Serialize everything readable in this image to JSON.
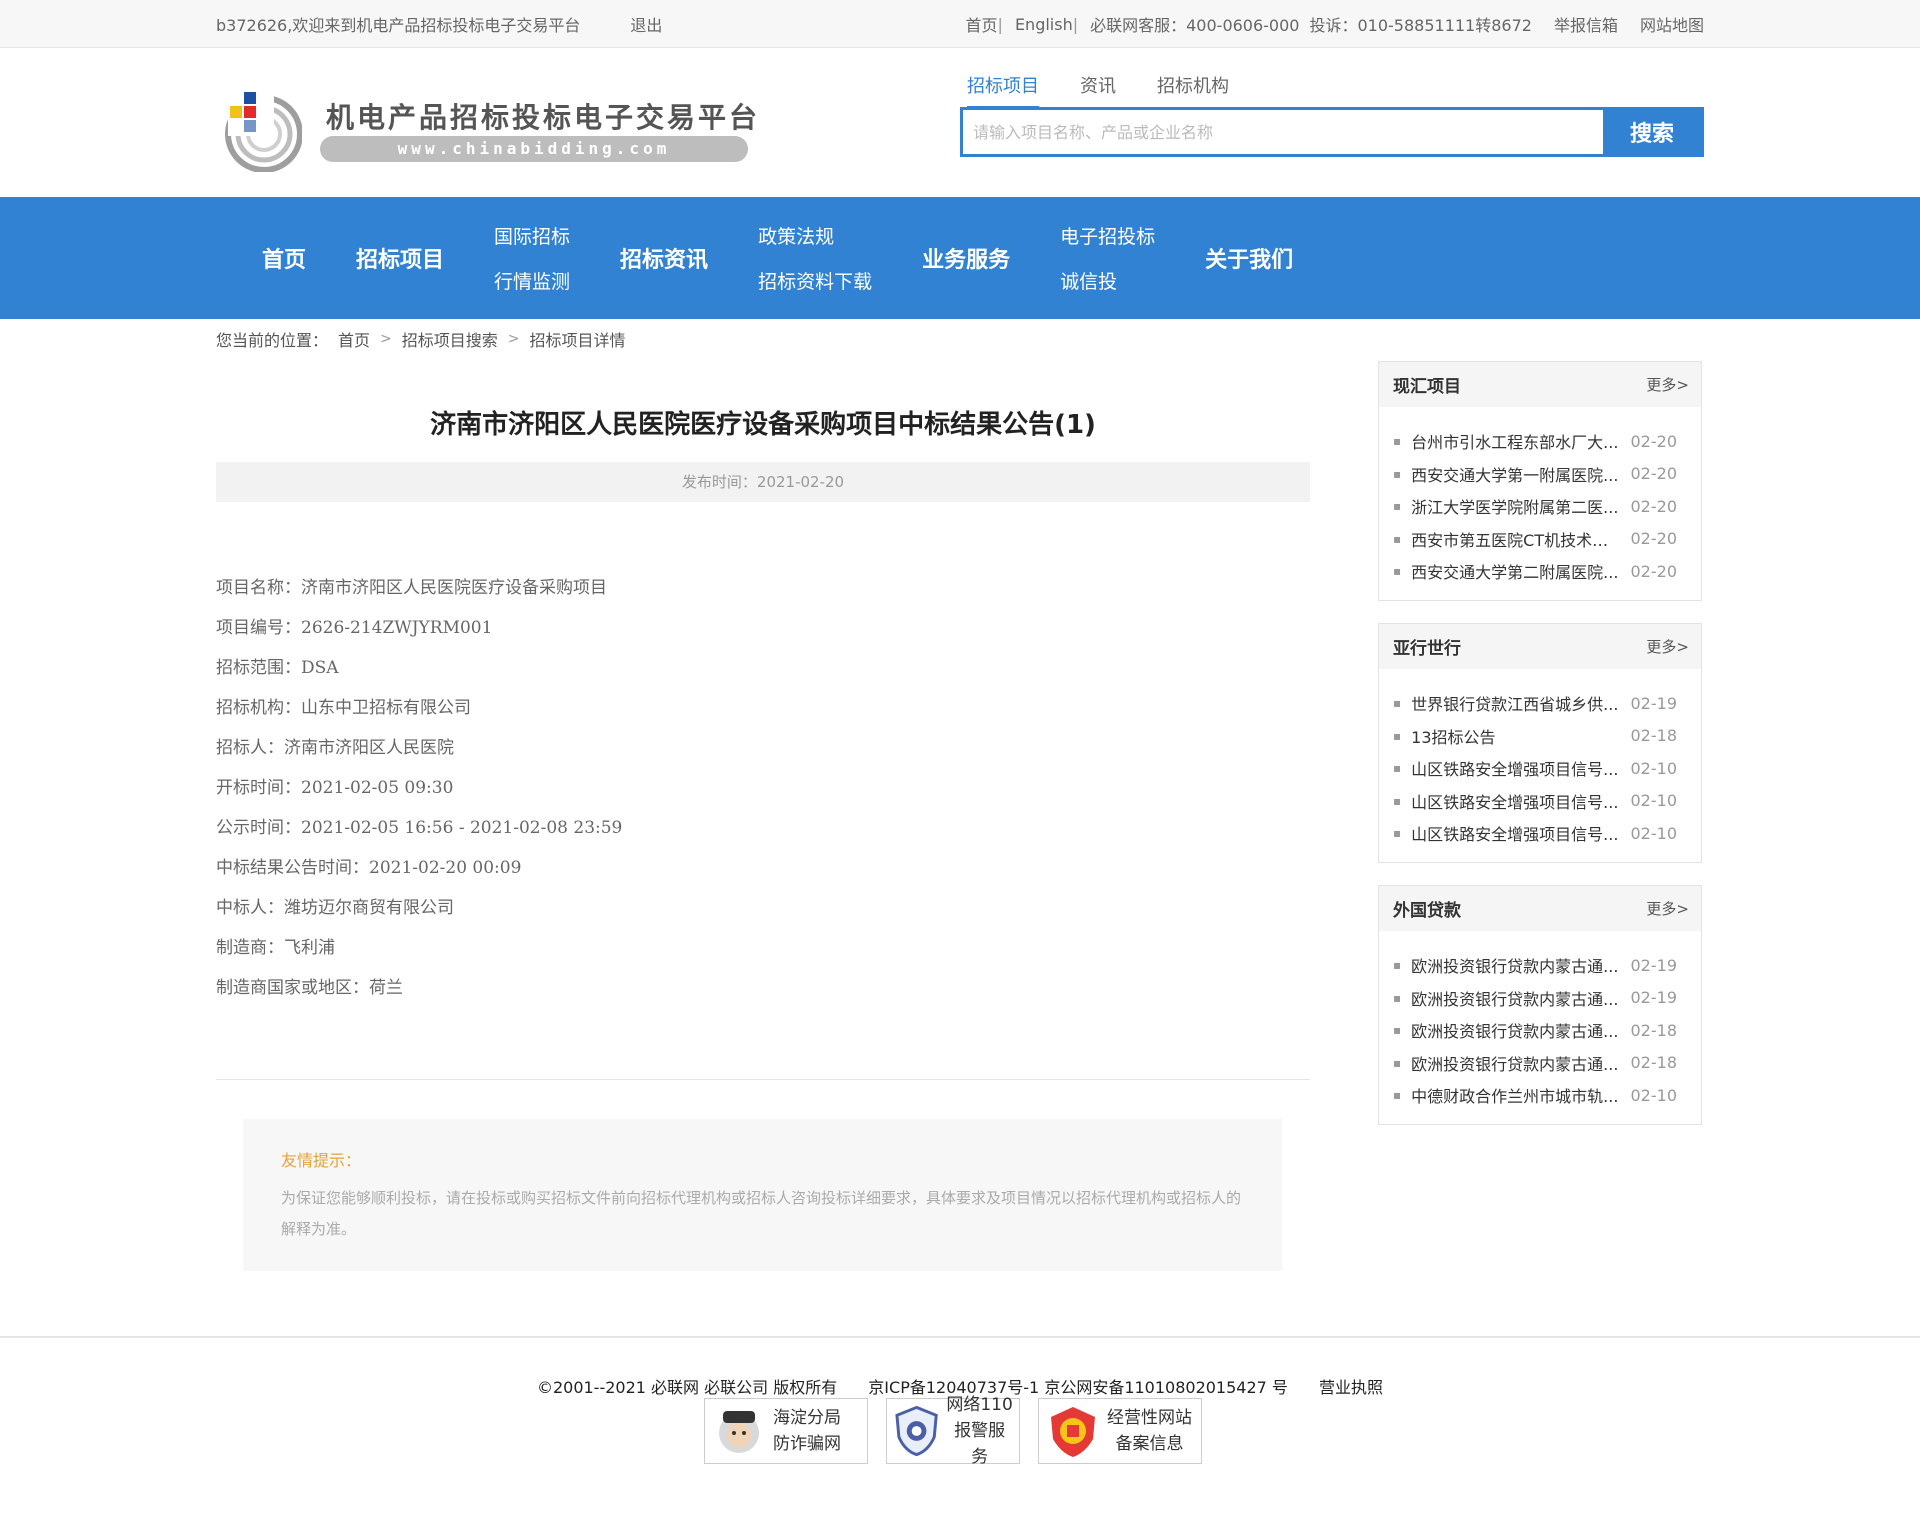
{
  "topbar": {
    "welcome": "b372626,欢迎来到机电产品招标投标电子交易平台",
    "logout": "退出",
    "home": "首页",
    "english": "English",
    "bilian": "必联网",
    "service": "客服：400-0606-000",
    "complaint": "投诉：010-58851111转8672",
    "report": "举报信箱",
    "sitemap": "网站地图"
  },
  "logo": {
    "title": "机电产品招标投标电子交易平台",
    "url": "www.chinabidding.com"
  },
  "search": {
    "tabs": [
      "招标项目",
      "资讯",
      "招标机构"
    ],
    "placeholder": "请输入项目名称、产品或企业名称",
    "button": "搜索"
  },
  "nav": {
    "home": "首页",
    "projects": "招标项目",
    "intl": "国际招标",
    "monitor": "行情监测",
    "news": "招标资讯",
    "policy": "政策法规",
    "download": "招标资料下载",
    "service": "业务服务",
    "ebid": "电子招投标",
    "credit": "诚信投",
    "about": "关于我们"
  },
  "breadcrumb": {
    "label": "您当前的位置：",
    "home": "首页",
    "search": "招标项目搜索",
    "detail": "招标项目详情"
  },
  "article": {
    "title": "济南市济阳区人民医院医疗设备采购项目中标结果公告(1)",
    "date": "发布时间：2021-02-20",
    "fields": [
      "项目名称：济南市济阳区人民医院医疗设备采购项目",
      "项目编号：2626-214ZWJYRM001",
      "招标范围：DSA",
      "招标机构：山东中卫招标有限公司",
      "招标人：济南市济阳区人民医院",
      "开标时间：2021-02-05 09:30",
      "公示时间：2021-02-05 16:56 - 2021-02-08 23:59",
      "中标结果公告时间：2021-02-20 00:09",
      "中标人：潍坊迈尔商贸有限公司",
      "制造商：飞利浦",
      "制造商国家或地区：荷兰"
    ]
  },
  "tips": {
    "title": "友情提示：",
    "body": "为保证您能够顺利投标，请在投标或购买招标文件前向招标代理机构或招标人咨询投标详细要求，具体要求及项目情况以招标代理机构或招标人的解释为准。"
  },
  "sidebar": [
    {
      "title": "现汇项目",
      "more": "更多",
      "items": [
        {
          "text": "台州市引水工程东部水厂大...",
          "date": "02-20"
        },
        {
          "text": "西安交通大学第一附属医院...",
          "date": "02-20"
        },
        {
          "text": "浙江大学医学院附属第二医...",
          "date": "02-20"
        },
        {
          "text": "西安市第五医院CT机技术人...",
          "date": "02-20"
        },
        {
          "text": "西安交通大学第二附属医院...",
          "date": "02-20"
        }
      ]
    },
    {
      "title": "亚行世行",
      "more": "更多",
      "items": [
        {
          "text": "世界银行贷款江西省城乡供...",
          "date": "02-19"
        },
        {
          "text": "13招标公告",
          "date": "02-18"
        },
        {
          "text": "山区铁路安全增强项目信号...",
          "date": "02-10"
        },
        {
          "text": "山区铁路安全增强项目信号...",
          "date": "02-10"
        },
        {
          "text": "山区铁路安全增强项目信号...",
          "date": "02-10"
        }
      ]
    },
    {
      "title": "外国贷款",
      "more": "更多",
      "items": [
        {
          "text": "欧洲投资银行贷款内蒙古通...",
          "date": "02-19"
        },
        {
          "text": "欧洲投资银行贷款内蒙古通...",
          "date": "02-19"
        },
        {
          "text": "欧洲投资银行贷款内蒙古通...",
          "date": "02-18"
        },
        {
          "text": "欧洲投资银行贷款内蒙古通...",
          "date": "02-18"
        },
        {
          "text": "中德财政合作兰州市城市轨...",
          "date": "02-10"
        }
      ]
    }
  ],
  "footer": {
    "copyright": "©2001--2021  必联网   必联公司  版权所有",
    "icp": "京ICP备12040737号-1  京公网安备11010802015427 号",
    "license": "营业执照",
    "badges": [
      {
        "line1": "海淀分局",
        "line2": "防诈骗网"
      },
      {
        "line1": "网络110",
        "line2": "报警服务"
      },
      {
        "line1": "经营性网站",
        "line2": "备案信息"
      }
    ]
  }
}
